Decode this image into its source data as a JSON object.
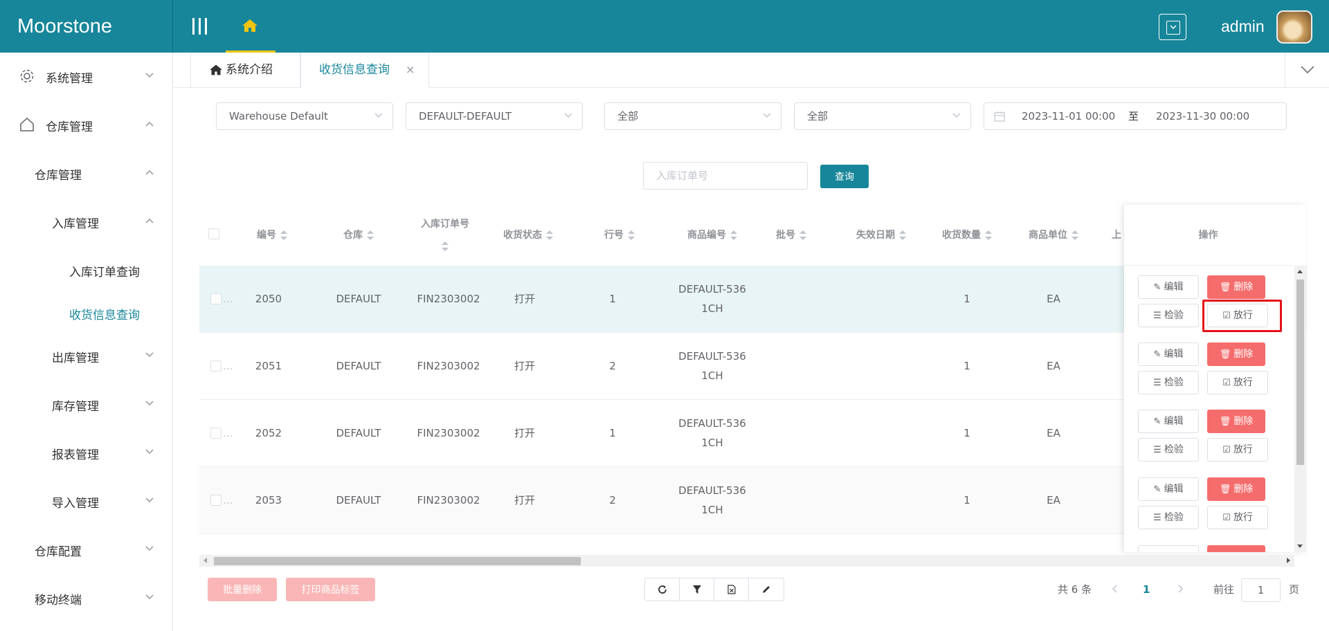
{
  "app": {
    "logo": "Moorstone",
    "user": "admin"
  },
  "sidebar": {
    "items": [
      {
        "label": "系统管理"
      },
      {
        "label": "仓库管理"
      },
      {
        "label": "仓库管理"
      },
      {
        "label": "入库管理"
      },
      {
        "label": "入库订单查询"
      },
      {
        "label": "收货信息查询"
      },
      {
        "label": "出库管理"
      },
      {
        "label": "库存管理"
      },
      {
        "label": "报表管理"
      },
      {
        "label": "导入管理"
      },
      {
        "label": "仓库配置"
      },
      {
        "label": "移动终端"
      }
    ]
  },
  "tabs": {
    "intro": "系统介绍",
    "current": "收货信息查询",
    "close": "×"
  },
  "filters": {
    "warehouse": "Warehouse Default",
    "owner": "DEFAULT-DEFAULT",
    "status1": "全部",
    "status2": "全部",
    "date_from": "2023-11-01 00:00",
    "date_sep": "至",
    "date_to": "2023-11-30 00:00",
    "order_placeholder": "入库订单号",
    "query_label": "查询"
  },
  "table": {
    "columns": {
      "id": "编号",
      "warehouse": "仓库",
      "order": "入库订单号",
      "status": "收货状态",
      "line": "行号",
      "sku": "商品编号",
      "batch": "批号",
      "expiry": "失效日期",
      "qty": "收货数量",
      "unit": "商品单位",
      "partial": "上",
      "ops": "操作"
    },
    "rows": [
      {
        "id": "2050",
        "warehouse": "DEFAULT",
        "order": "FIN2303002",
        "status": "打开",
        "line": "1",
        "sku1": "DEFAULT-536",
        "sku2": "1CH",
        "qty": "1",
        "unit": "EA"
      },
      {
        "id": "2051",
        "warehouse": "DEFAULT",
        "order": "FIN2303002",
        "status": "打开",
        "line": "2",
        "sku1": "DEFAULT-536",
        "sku2": "1CH",
        "qty": "1",
        "unit": "EA"
      },
      {
        "id": "2052",
        "warehouse": "DEFAULT",
        "order": "FIN2303002",
        "status": "打开",
        "line": "1",
        "sku1": "DEFAULT-536",
        "sku2": "1CH",
        "qty": "1",
        "unit": "EA"
      },
      {
        "id": "2053",
        "warehouse": "DEFAULT",
        "order": "FIN2303002",
        "status": "打开",
        "line": "2",
        "sku1": "DEFAULT-536",
        "sku2": "1CH",
        "qty": "1",
        "unit": "EA"
      }
    ],
    "actions": {
      "edit": "编辑",
      "delete": "删除",
      "inspect": "检验",
      "release": "放行"
    },
    "checkbox_ellipsis": "..."
  },
  "footer": {
    "bulk_delete": "批量删除",
    "print_labels": "打印商品标签",
    "total": "共 6 条",
    "current_page": "1",
    "goto": "前往",
    "goto_value": "1",
    "page_suffix": "页"
  },
  "colors": {
    "primary": "#17869a",
    "danger": "#f56c6c",
    "accent": "#f1c40f",
    "highlight": "#e4111a"
  }
}
